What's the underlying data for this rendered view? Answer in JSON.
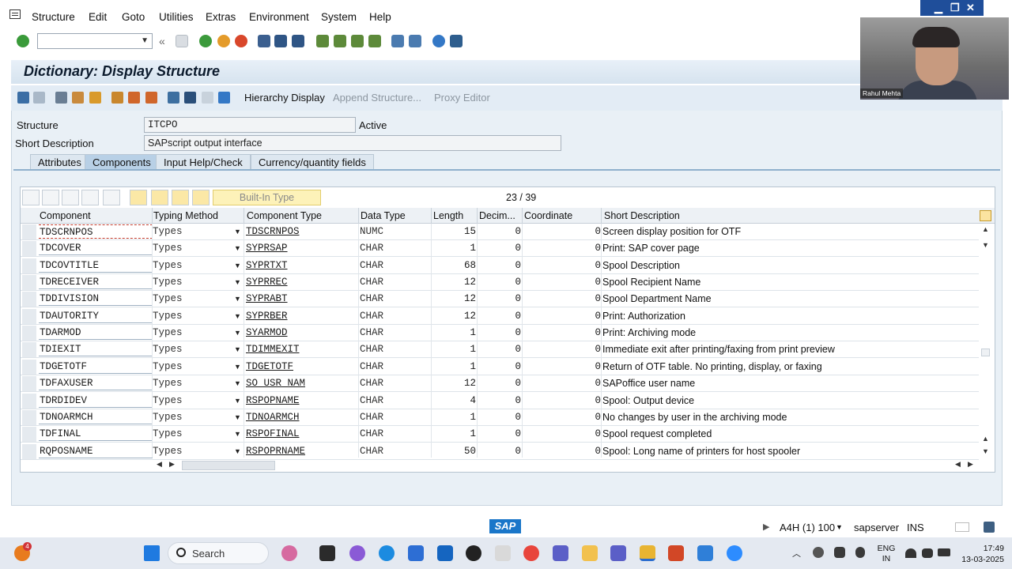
{
  "menu": [
    "Structure",
    "Edit",
    "Goto",
    "Utilities",
    "Extras",
    "Environment",
    "System",
    "Help"
  ],
  "window_controls": [
    "▁",
    "❐",
    "✕"
  ],
  "title": "Dictionary: Display Structure",
  "app_toolbar": {
    "hierarchy": "Hierarchy Display",
    "append": "Append Structure...",
    "proxy": "Proxy Editor"
  },
  "form": {
    "structure_label": "Structure",
    "structure_value": "ITCPO",
    "status": "Active",
    "short_desc_label": "Short Description",
    "short_desc_value": "SAPscript output interface"
  },
  "tabs": [
    "Attributes",
    "Components",
    "Input Help/Check",
    "Currency/quantity fields"
  ],
  "active_tab": "Components",
  "table_toolbar": {
    "builtin": "Built-In Type",
    "counter": "23  /  39"
  },
  "columns": [
    "Component",
    "Typing Method",
    "Component Type",
    "Data Type",
    "Length",
    "Decim...",
    "Coordinate",
    "Short Description"
  ],
  "rows": [
    {
      "comp": "TDSCRNPOS",
      "typ": "Types",
      "ctype": "TDSCRNPOS",
      "dtype": "NUMC",
      "len": "15",
      "dec": "0",
      "coord": "0",
      "desc": "Screen display position for OTF"
    },
    {
      "comp": "TDCOVER",
      "typ": "Types",
      "ctype": "SYPRSAP",
      "dtype": "CHAR",
      "len": "1",
      "dec": "0",
      "coord": "0",
      "desc": "Print: SAP cover page"
    },
    {
      "comp": "TDCOVTITLE",
      "typ": "Types",
      "ctype": "SYPRTXT",
      "dtype": "CHAR",
      "len": "68",
      "dec": "0",
      "coord": "0",
      "desc": "Spool Description"
    },
    {
      "comp": "TDRECEIVER",
      "typ": "Types",
      "ctype": "SYPRREC",
      "dtype": "CHAR",
      "len": "12",
      "dec": "0",
      "coord": "0",
      "desc": "Spool Recipient Name"
    },
    {
      "comp": "TDDIVISION",
      "typ": "Types",
      "ctype": "SYPRABT",
      "dtype": "CHAR",
      "len": "12",
      "dec": "0",
      "coord": "0",
      "desc": "Spool Department Name"
    },
    {
      "comp": "TDAUTORITY",
      "typ": "Types",
      "ctype": "SYPRBER",
      "dtype": "CHAR",
      "len": "12",
      "dec": "0",
      "coord": "0",
      "desc": "Print: Authorization"
    },
    {
      "comp": "TDARMOD",
      "typ": "Types",
      "ctype": "SYARMOD",
      "dtype": "CHAR",
      "len": "1",
      "dec": "0",
      "coord": "0",
      "desc": "Print: Archiving mode"
    },
    {
      "comp": "TDIEXIT",
      "typ": "Types",
      "ctype": "TDIMMEXIT",
      "dtype": "CHAR",
      "len": "1",
      "dec": "0",
      "coord": "0",
      "desc": "Immediate exit after printing/faxing from print preview"
    },
    {
      "comp": "TDGETOTF",
      "typ": "Types",
      "ctype": "TDGETOTF",
      "dtype": "CHAR",
      "len": "1",
      "dec": "0",
      "coord": "0",
      "desc": "Return of OTF table. No printing, display, or faxing"
    },
    {
      "comp": "TDFAXUSER",
      "typ": "Types",
      "ctype": "SO_USR_NAM",
      "dtype": "CHAR",
      "len": "12",
      "dec": "0",
      "coord": "0",
      "desc": "SAPoffice user name"
    },
    {
      "comp": "TDRDIDEV",
      "typ": "Types",
      "ctype": "RSPOPNAME",
      "dtype": "CHAR",
      "len": "4",
      "dec": "0",
      "coord": "0",
      "desc": "Spool: Output device"
    },
    {
      "comp": "TDNOARMCH",
      "typ": "Types",
      "ctype": "TDNOARMCH",
      "dtype": "CHAR",
      "len": "1",
      "dec": "0",
      "coord": "0",
      "desc": "No changes by user in the archiving mode"
    },
    {
      "comp": "TDFINAL",
      "typ": "Types",
      "ctype": "RSPOFINAL",
      "dtype": "CHAR",
      "len": "1",
      "dec": "0",
      "coord": "0",
      "desc": "Spool request completed"
    },
    {
      "comp": "RQPOSNAME",
      "typ": "Types",
      "ctype": "RSPOPRNAME",
      "dtype": "CHAR",
      "len": "50",
      "dec": "0",
      "coord": "0",
      "desc": "Spool: Long name of printers for host spooler"
    }
  ],
  "statusbar": {
    "logo": "SAP",
    "system": "A4H (1) 100",
    "server": "sapserver",
    "mode": "INS"
  },
  "taskbar": {
    "search": "Search",
    "lang_top": "ENG",
    "lang_bottom": "IN",
    "time": "17:49",
    "date": "13-03-2025",
    "notif_badge": "4"
  },
  "webcam": {
    "name": "Rahul Mehta"
  },
  "colors": {
    "accent": "#1a76c9",
    "title_bg": "#d6e3ef",
    "tab_active": "#b8d0e6"
  }
}
